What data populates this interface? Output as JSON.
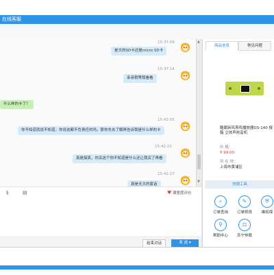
{
  "window": {
    "title": "在线客服"
  },
  "messages": [
    {
      "time": "15:37:09",
      "text": "是大的SD卡还是micro SD卡",
      "side": "right"
    },
    {
      "time": "15:37:14",
      "text": "亲亲稍等我看看",
      "side": "right"
    },
    {
      "time": "",
      "text": "什么样的卡了？",
      "side": "left"
    },
    {
      "time": "15:42:05",
      "text": "你不知道就说不知道，你说这都不负责任的吗，那你先去了解再告诉我是什么样的卡",
      "side": "right"
    },
    {
      "time": "15:42:22",
      "text": "真是搞笑，你买这个你不知道是什么还让我买了再看",
      "side": "right"
    },
    {
      "time": "15:42:27",
      "text": "真是无大的家话",
      "side": "right"
    }
  ],
  "toolbar": {
    "rate_label": "满意度评价"
  },
  "buttons": {
    "end_chat": "结束对话",
    "send": "发 送 ▾"
  },
  "sidebar": {
    "tabs": [
      "商品信息",
      "常见问题"
    ],
    "product": {
      "name_line1": "酷属新风燕鸣播放器DS-140 报",
      "name_line2": "箱 立体声收音机",
      "price_label": "价 格：",
      "price": "¥ 99.00",
      "location_label": "所 在 地：",
      "location": "上海市黄浦区"
    },
    "tools_title": "快捷工具",
    "tools": [
      {
        "label": "订单查询",
        "icon": "search-icon",
        "glyph": "⌕"
      },
      {
        "label": "订单修改",
        "icon": "pencil-icon",
        "glyph": "✎"
      },
      {
        "label": "维权保",
        "icon": "shield-icon",
        "glyph": "⛨"
      },
      {
        "label": "帮助中心",
        "icon": "pin-icon",
        "glyph": "⚲"
      },
      {
        "label": "苏宁仲裁",
        "icon": "scales-icon",
        "glyph": "⚖"
      }
    ]
  },
  "colors": {
    "accent": "#2f94e6",
    "bubble": "#d6ebfa",
    "bubble_green": "#c6f0b6",
    "price": "#e8380d"
  }
}
